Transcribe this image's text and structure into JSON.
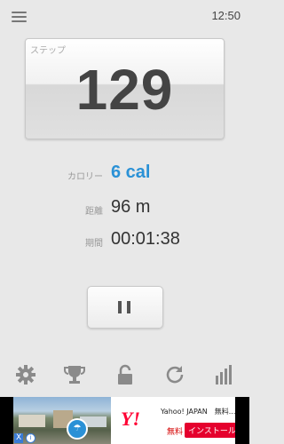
{
  "status_bar": {
    "time": "12:50"
  },
  "steps": {
    "label": "ステップ",
    "value": "129"
  },
  "stats": {
    "calories": {
      "label": "カロリー",
      "value": "6 cal"
    },
    "distance": {
      "label": "距離",
      "value": "96 m"
    },
    "duration": {
      "label": "期間",
      "value": "00:01:38"
    }
  },
  "colors": {
    "accent": "#2a91d6",
    "background": "#e8e8e8",
    "ad_red": "#e5002d"
  },
  "nav_icons": [
    "gear-icon",
    "trophy-icon",
    "lock-icon",
    "refresh-icon",
    "bar-chart-icon"
  ],
  "ad": {
    "logo": "Y!",
    "title": "Yahoo! JAPAN　無料...",
    "free_label": "無料",
    "install_label": "インストール",
    "close_label": "X"
  }
}
